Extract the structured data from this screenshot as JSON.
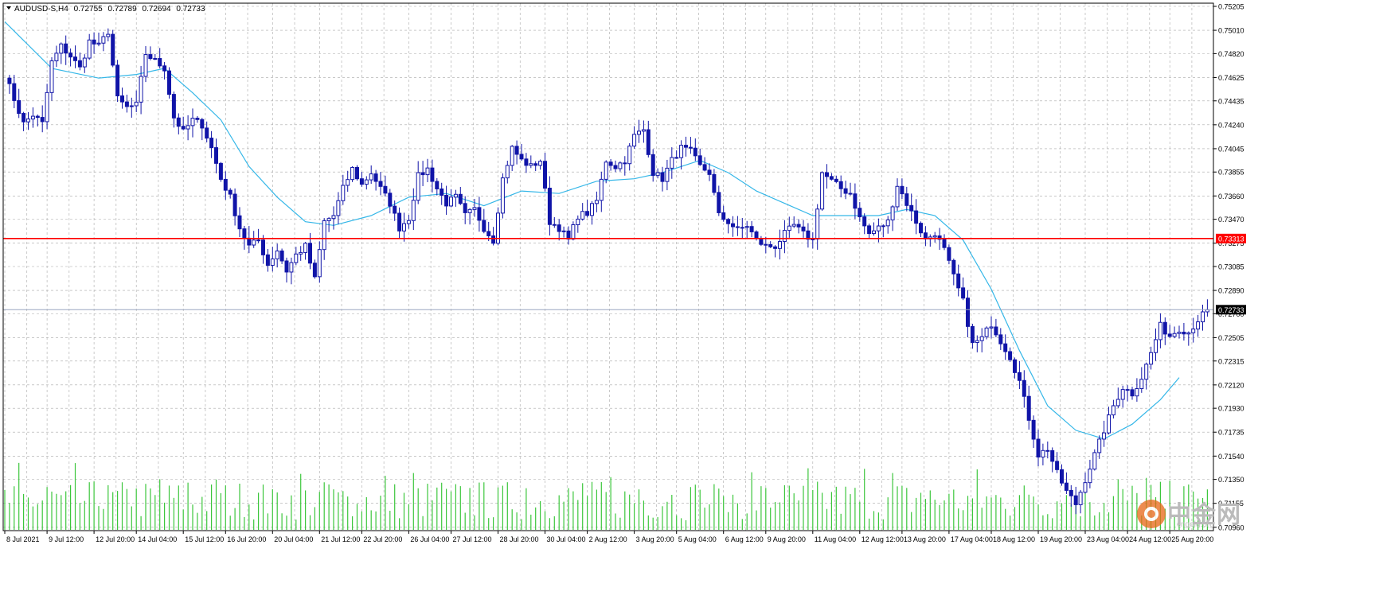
{
  "header": {
    "symbol": "AUDUSD-S,H4",
    "open": "0.72755",
    "high": "0.72789",
    "low": "0.72694",
    "close": "0.72733"
  },
  "watermark": {
    "text": "中金网",
    "sub": "cngold.org",
    "colors": {
      "circle": "#e86a1a",
      "inner": "#ffffff"
    }
  },
  "colors": {
    "candle": "#1014a8",
    "ma": "#35b7e8",
    "level_line": "#ff0000",
    "level_label_bg": "#ff0000",
    "current_line": "#9aa6c0",
    "current_label_bg": "#000000",
    "volume": "#3cc63c",
    "grid": "#a8a8a8"
  },
  "chart_data": {
    "type": "candlestick",
    "timeframe": "H4",
    "ylim": [
      0.70965,
      0.75205
    ],
    "yticks": [
      "0.75205",
      "0.75010",
      "0.74820",
      "0.74625",
      "0.74435",
      "0.74240",
      "0.74045",
      "0.73855",
      "0.73660",
      "0.73470",
      "0.73275",
      "0.73085",
      "0.72890",
      "0.72700",
      "0.72505",
      "0.72315",
      "0.72120",
      "0.71930",
      "0.71735",
      "0.71540",
      "0.71350",
      "0.71155",
      "0.70960"
    ],
    "xticks": [
      {
        "i": 0,
        "label": "8 Jul 2021"
      },
      {
        "i": 9,
        "label": "9 Jul 12:00"
      },
      {
        "i": 19,
        "label": "12 Jul 20:00"
      },
      {
        "i": 28,
        "label": "14 Jul 04:00"
      },
      {
        "i": 38,
        "label": "15 Jul 12:00"
      },
      {
        "i": 47,
        "label": "16 Jul 20:00"
      },
      {
        "i": 57,
        "label": "20 Jul 04:00"
      },
      {
        "i": 67,
        "label": "21 Jul 12:00"
      },
      {
        "i": 76,
        "label": "22 Jul 20:00"
      },
      {
        "i": 86,
        "label": "26 Jul 04:00"
      },
      {
        "i": 95,
        "label": "27 Jul 12:00"
      },
      {
        "i": 105,
        "label": "28 Jul 20:00"
      },
      {
        "i": 115,
        "label": "30 Jul 04:00"
      },
      {
        "i": 124,
        "label": "2 Aug 12:00"
      },
      {
        "i": 134,
        "label": "3 Aug 20:00"
      },
      {
        "i": 143,
        "label": "5 Aug 04:00"
      },
      {
        "i": 153,
        "label": "6 Aug 12:00"
      },
      {
        "i": 162,
        "label": "9 Aug 20:00"
      },
      {
        "i": 172,
        "label": "11 Aug 04:00"
      },
      {
        "i": 182,
        "label": "12 Aug 12:00"
      },
      {
        "i": 191,
        "label": "13 Aug 20:00"
      },
      {
        "i": 201,
        "label": "17 Aug 04:00"
      },
      {
        "i": 210,
        "label": "18 Aug 12:00"
      },
      {
        "i": 220,
        "label": "19 Aug 20:00"
      },
      {
        "i": 230,
        "label": "23 Aug 04:00"
      },
      {
        "i": 239,
        "label": "24 Aug 12:00"
      },
      {
        "i": 248,
        "label": "25 Aug 20:00"
      }
    ],
    "level_line": {
      "value": 0.73313,
      "label": "0.73313"
    },
    "current_price": {
      "value": 0.72733,
      "label": "0.72733"
    },
    "keypoints": [
      [
        0,
        0.7465
      ],
      [
        2,
        0.7445
      ],
      [
        4,
        0.7425
      ],
      [
        6,
        0.7432
      ],
      [
        8,
        0.7425
      ],
      [
        10,
        0.7475
      ],
      [
        12,
        0.7488
      ],
      [
        14,
        0.748
      ],
      [
        16,
        0.747
      ],
      [
        18,
        0.7492
      ],
      [
        20,
        0.7488
      ],
      [
        22,
        0.75
      ],
      [
        24,
        0.7445
      ],
      [
        26,
        0.7438
      ],
      [
        28,
        0.744
      ],
      [
        30,
        0.7482
      ],
      [
        32,
        0.7476
      ],
      [
        34,
        0.747
      ],
      [
        36,
        0.743
      ],
      [
        38,
        0.7418
      ],
      [
        40,
        0.7428
      ],
      [
        42,
        0.7424
      ],
      [
        44,
        0.7405
      ],
      [
        46,
        0.738
      ],
      [
        48,
        0.7365
      ],
      [
        50,
        0.734
      ],
      [
        52,
        0.7325
      ],
      [
        54,
        0.733
      ],
      [
        56,
        0.731
      ],
      [
        58,
        0.7322
      ],
      [
        60,
        0.7305
      ],
      [
        62,
        0.7318
      ],
      [
        64,
        0.7325
      ],
      [
        66,
        0.7298
      ],
      [
        68,
        0.7345
      ],
      [
        70,
        0.735
      ],
      [
        72,
        0.7372
      ],
      [
        74,
        0.7388
      ],
      [
        76,
        0.7375
      ],
      [
        78,
        0.7385
      ],
      [
        80,
        0.7372
      ],
      [
        82,
        0.736
      ],
      [
        84,
        0.734
      ],
      [
        86,
        0.7348
      ],
      [
        88,
        0.7382
      ],
      [
        90,
        0.7388
      ],
      [
        92,
        0.7372
      ],
      [
        94,
        0.736
      ],
      [
        96,
        0.7365
      ],
      [
        98,
        0.735
      ],
      [
        100,
        0.7355
      ],
      [
        102,
        0.734
      ],
      [
        104,
        0.733
      ],
      [
        106,
        0.738
      ],
      [
        108,
        0.7405
      ],
      [
        110,
        0.7395
      ],
      [
        112,
        0.739
      ],
      [
        114,
        0.7395
      ],
      [
        116,
        0.7345
      ],
      [
        118,
        0.734
      ],
      [
        120,
        0.733
      ],
      [
        122,
        0.735
      ],
      [
        124,
        0.7352
      ],
      [
        126,
        0.7362
      ],
      [
        128,
        0.7395
      ],
      [
        130,
        0.739
      ],
      [
        132,
        0.7395
      ],
      [
        134,
        0.7415
      ],
      [
        136,
        0.742
      ],
      [
        138,
        0.7385
      ],
      [
        140,
        0.738
      ],
      [
        142,
        0.7395
      ],
      [
        144,
        0.7405
      ],
      [
        146,
        0.7402
      ],
      [
        148,
        0.739
      ],
      [
        150,
        0.7385
      ],
      [
        152,
        0.735
      ],
      [
        154,
        0.7345
      ],
      [
        156,
        0.7338
      ],
      [
        158,
        0.7342
      ],
      [
        160,
        0.733
      ],
      [
        162,
        0.7325
      ],
      [
        164,
        0.7325
      ],
      [
        166,
        0.7335
      ],
      [
        168,
        0.7342
      ],
      [
        170,
        0.7335
      ],
      [
        172,
        0.733
      ],
      [
        174,
        0.7385
      ],
      [
        176,
        0.7378
      ],
      [
        178,
        0.7372
      ],
      [
        180,
        0.7368
      ],
      [
        182,
        0.7348
      ],
      [
        184,
        0.7335
      ],
      [
        186,
        0.734
      ],
      [
        188,
        0.7345
      ],
      [
        190,
        0.7375
      ],
      [
        192,
        0.736
      ],
      [
        194,
        0.7345
      ],
      [
        196,
        0.733
      ],
      [
        198,
        0.7336
      ],
      [
        200,
        0.7322
      ],
      [
        202,
        0.73
      ],
      [
        204,
        0.728
      ],
      [
        206,
        0.7245
      ],
      [
        208,
        0.725
      ],
      [
        210,
        0.7262
      ],
      [
        212,
        0.7248
      ],
      [
        214,
        0.7235
      ],
      [
        216,
        0.7215
      ],
      [
        218,
        0.7185
      ],
      [
        220,
        0.7155
      ],
      [
        222,
        0.716
      ],
      [
        224,
        0.714
      ],
      [
        226,
        0.7125
      ],
      [
        228,
        0.7115
      ],
      [
        230,
        0.7135
      ],
      [
        232,
        0.7155
      ],
      [
        234,
        0.7175
      ],
      [
        236,
        0.7195
      ],
      [
        238,
        0.721
      ],
      [
        240,
        0.7205
      ],
      [
        242,
        0.7218
      ],
      [
        244,
        0.7238
      ],
      [
        246,
        0.726
      ],
      [
        248,
        0.7252
      ],
      [
        250,
        0.7258
      ],
      [
        252,
        0.7255
      ],
      [
        254,
        0.7265
      ],
      [
        256,
        0.7273
      ]
    ],
    "moving_average": [
      [
        0,
        0.7508
      ],
      [
        10,
        0.747
      ],
      [
        20,
        0.7462
      ],
      [
        28,
        0.7465
      ],
      [
        34,
        0.747
      ],
      [
        40,
        0.745
      ],
      [
        46,
        0.7428
      ],
      [
        52,
        0.739
      ],
      [
        58,
        0.7365
      ],
      [
        64,
        0.7345
      ],
      [
        70,
        0.7342
      ],
      [
        78,
        0.735
      ],
      [
        86,
        0.7365
      ],
      [
        94,
        0.7368
      ],
      [
        102,
        0.7358
      ],
      [
        110,
        0.737
      ],
      [
        118,
        0.7368
      ],
      [
        126,
        0.7378
      ],
      [
        134,
        0.738
      ],
      [
        140,
        0.7385
      ],
      [
        148,
        0.7395
      ],
      [
        154,
        0.7385
      ],
      [
        160,
        0.737
      ],
      [
        166,
        0.736
      ],
      [
        172,
        0.735
      ],
      [
        178,
        0.735
      ],
      [
        186,
        0.735
      ],
      [
        192,
        0.7355
      ],
      [
        198,
        0.735
      ],
      [
        204,
        0.733
      ],
      [
        210,
        0.729
      ],
      [
        216,
        0.724
      ],
      [
        222,
        0.7195
      ],
      [
        228,
        0.7175
      ],
      [
        234,
        0.7168
      ],
      [
        240,
        0.718
      ],
      [
        246,
        0.72
      ],
      [
        250,
        0.7218
      ]
    ]
  }
}
